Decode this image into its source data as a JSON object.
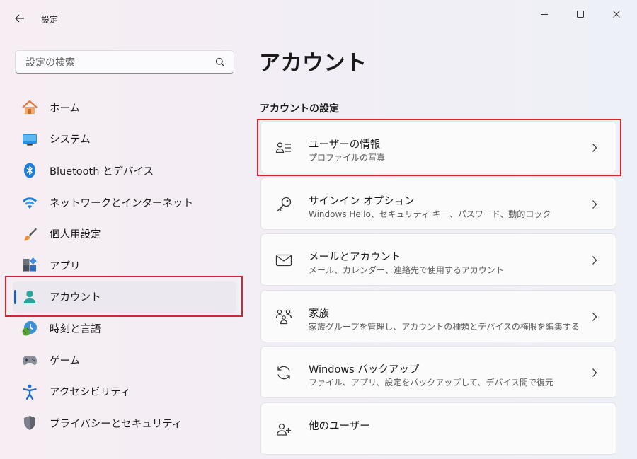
{
  "window": {
    "title": "設定"
  },
  "search": {
    "placeholder": "設定の検索",
    "value": ""
  },
  "sidebar": {
    "items": [
      {
        "label": "ホーム",
        "icon": "home-icon"
      },
      {
        "label": "システム",
        "icon": "monitor-icon"
      },
      {
        "label": "Bluetooth とデバイス",
        "icon": "bluetooth-icon"
      },
      {
        "label": "ネットワークとインターネット",
        "icon": "wifi-icon"
      },
      {
        "label": "個人用設定",
        "icon": "paintbrush-icon"
      },
      {
        "label": "アプリ",
        "icon": "apps-icon"
      },
      {
        "label": "アカウント",
        "icon": "person-icon",
        "selected": true
      },
      {
        "label": "時刻と言語",
        "icon": "clock-globe-icon"
      },
      {
        "label": "ゲーム",
        "icon": "gamepad-icon"
      },
      {
        "label": "アクセシビリティ",
        "icon": "accessibility-icon"
      },
      {
        "label": "プライバシーとセキュリティ",
        "icon": "shield-icon"
      }
    ]
  },
  "main": {
    "title": "アカウント",
    "section_title": "アカウントの設定",
    "cards": [
      {
        "title": "ユーザーの情報",
        "subtitle": "プロファイルの写真",
        "icon": "user-info-icon"
      },
      {
        "title": "サインイン オプション",
        "subtitle": "Windows Hello、セキュリティ キー、パスワード、動的ロック",
        "icon": "key-icon"
      },
      {
        "title": "メールとアカウント",
        "subtitle": "メール、カレンダー、連絡先で使用するアカウント",
        "icon": "mail-icon"
      },
      {
        "title": "家族",
        "subtitle": "家族グループを管理し、アカウントの種類とデバイスの権限を編集する",
        "icon": "family-icon"
      },
      {
        "title": "Windows バックアップ",
        "subtitle": "ファイル、アプリ、設定をバックアップして、デバイス間で復元",
        "icon": "sync-icon"
      },
      {
        "title": "他のユーザー",
        "subtitle": "",
        "icon": "other-users-icon"
      }
    ]
  },
  "colors": {
    "accent": "#1e5fb3",
    "highlight": "#d9232d",
    "person_icon": "#2aa59c"
  }
}
